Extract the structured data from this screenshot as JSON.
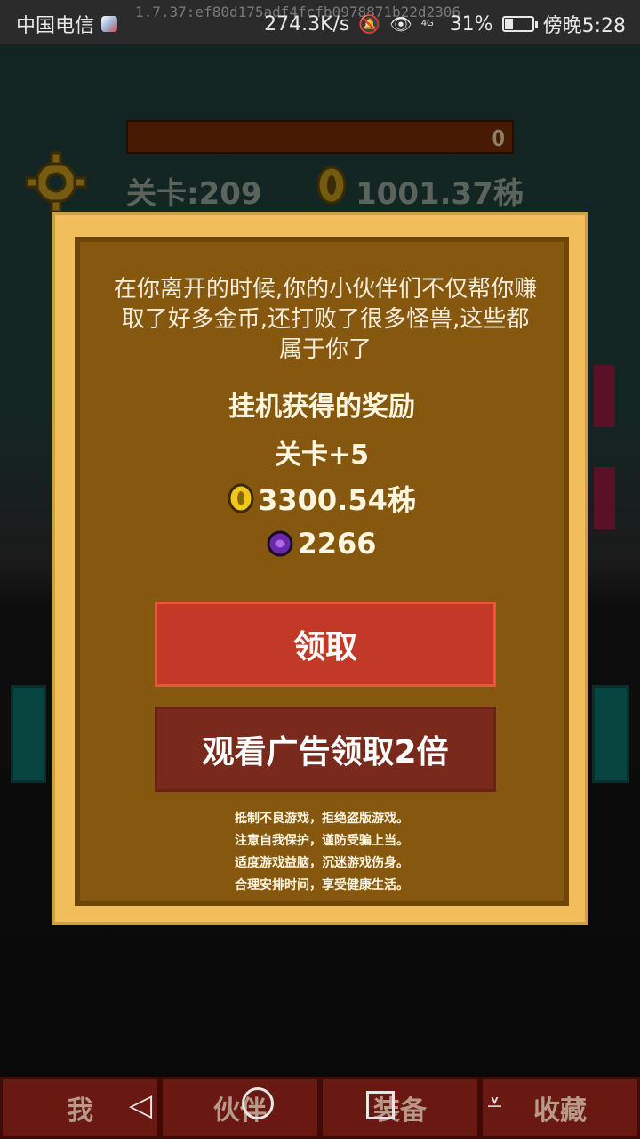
{
  "status_bar": {
    "carrier": "中国电信",
    "debug_text": "1.7.37:ef80d175adf4fcfb0978871b22d2306",
    "speed": "274.3K/s",
    "signal": "4G",
    "battery": "31%",
    "battery_level": 0.31,
    "time": "傍晚5:28"
  },
  "game": {
    "hp_value": "0",
    "level_label": "关卡:209",
    "coins": "1001.37秭"
  },
  "dialog": {
    "message": "在你离开的时候,你的小伙伴们不仅帮你赚取了好多金币,还打败了很多怪兽,这些都属于你了",
    "title": "挂机获得的奖励",
    "level_reward": "关卡+5",
    "coin_reward": "3300.54秭",
    "gem_reward": "2266",
    "claim_button": "领取",
    "ad_button": "观看广告领取2倍",
    "notice": [
      "抵制不良游戏，拒绝盗版游戏。",
      "注意自我保护，谨防受骗上当。",
      "适度游戏益脑，沉迷游戏伤身。",
      "合理安排时间，享受健康生活。"
    ]
  },
  "bottom_nav": {
    "tabs": [
      "我",
      "伙伴",
      "装备",
      "收藏"
    ]
  },
  "colors": {
    "dialog_frame": "#f2be5c",
    "dialog_body": "#85570f",
    "claim_button": "#c23a27",
    "ad_button": "#7a2a1c"
  }
}
